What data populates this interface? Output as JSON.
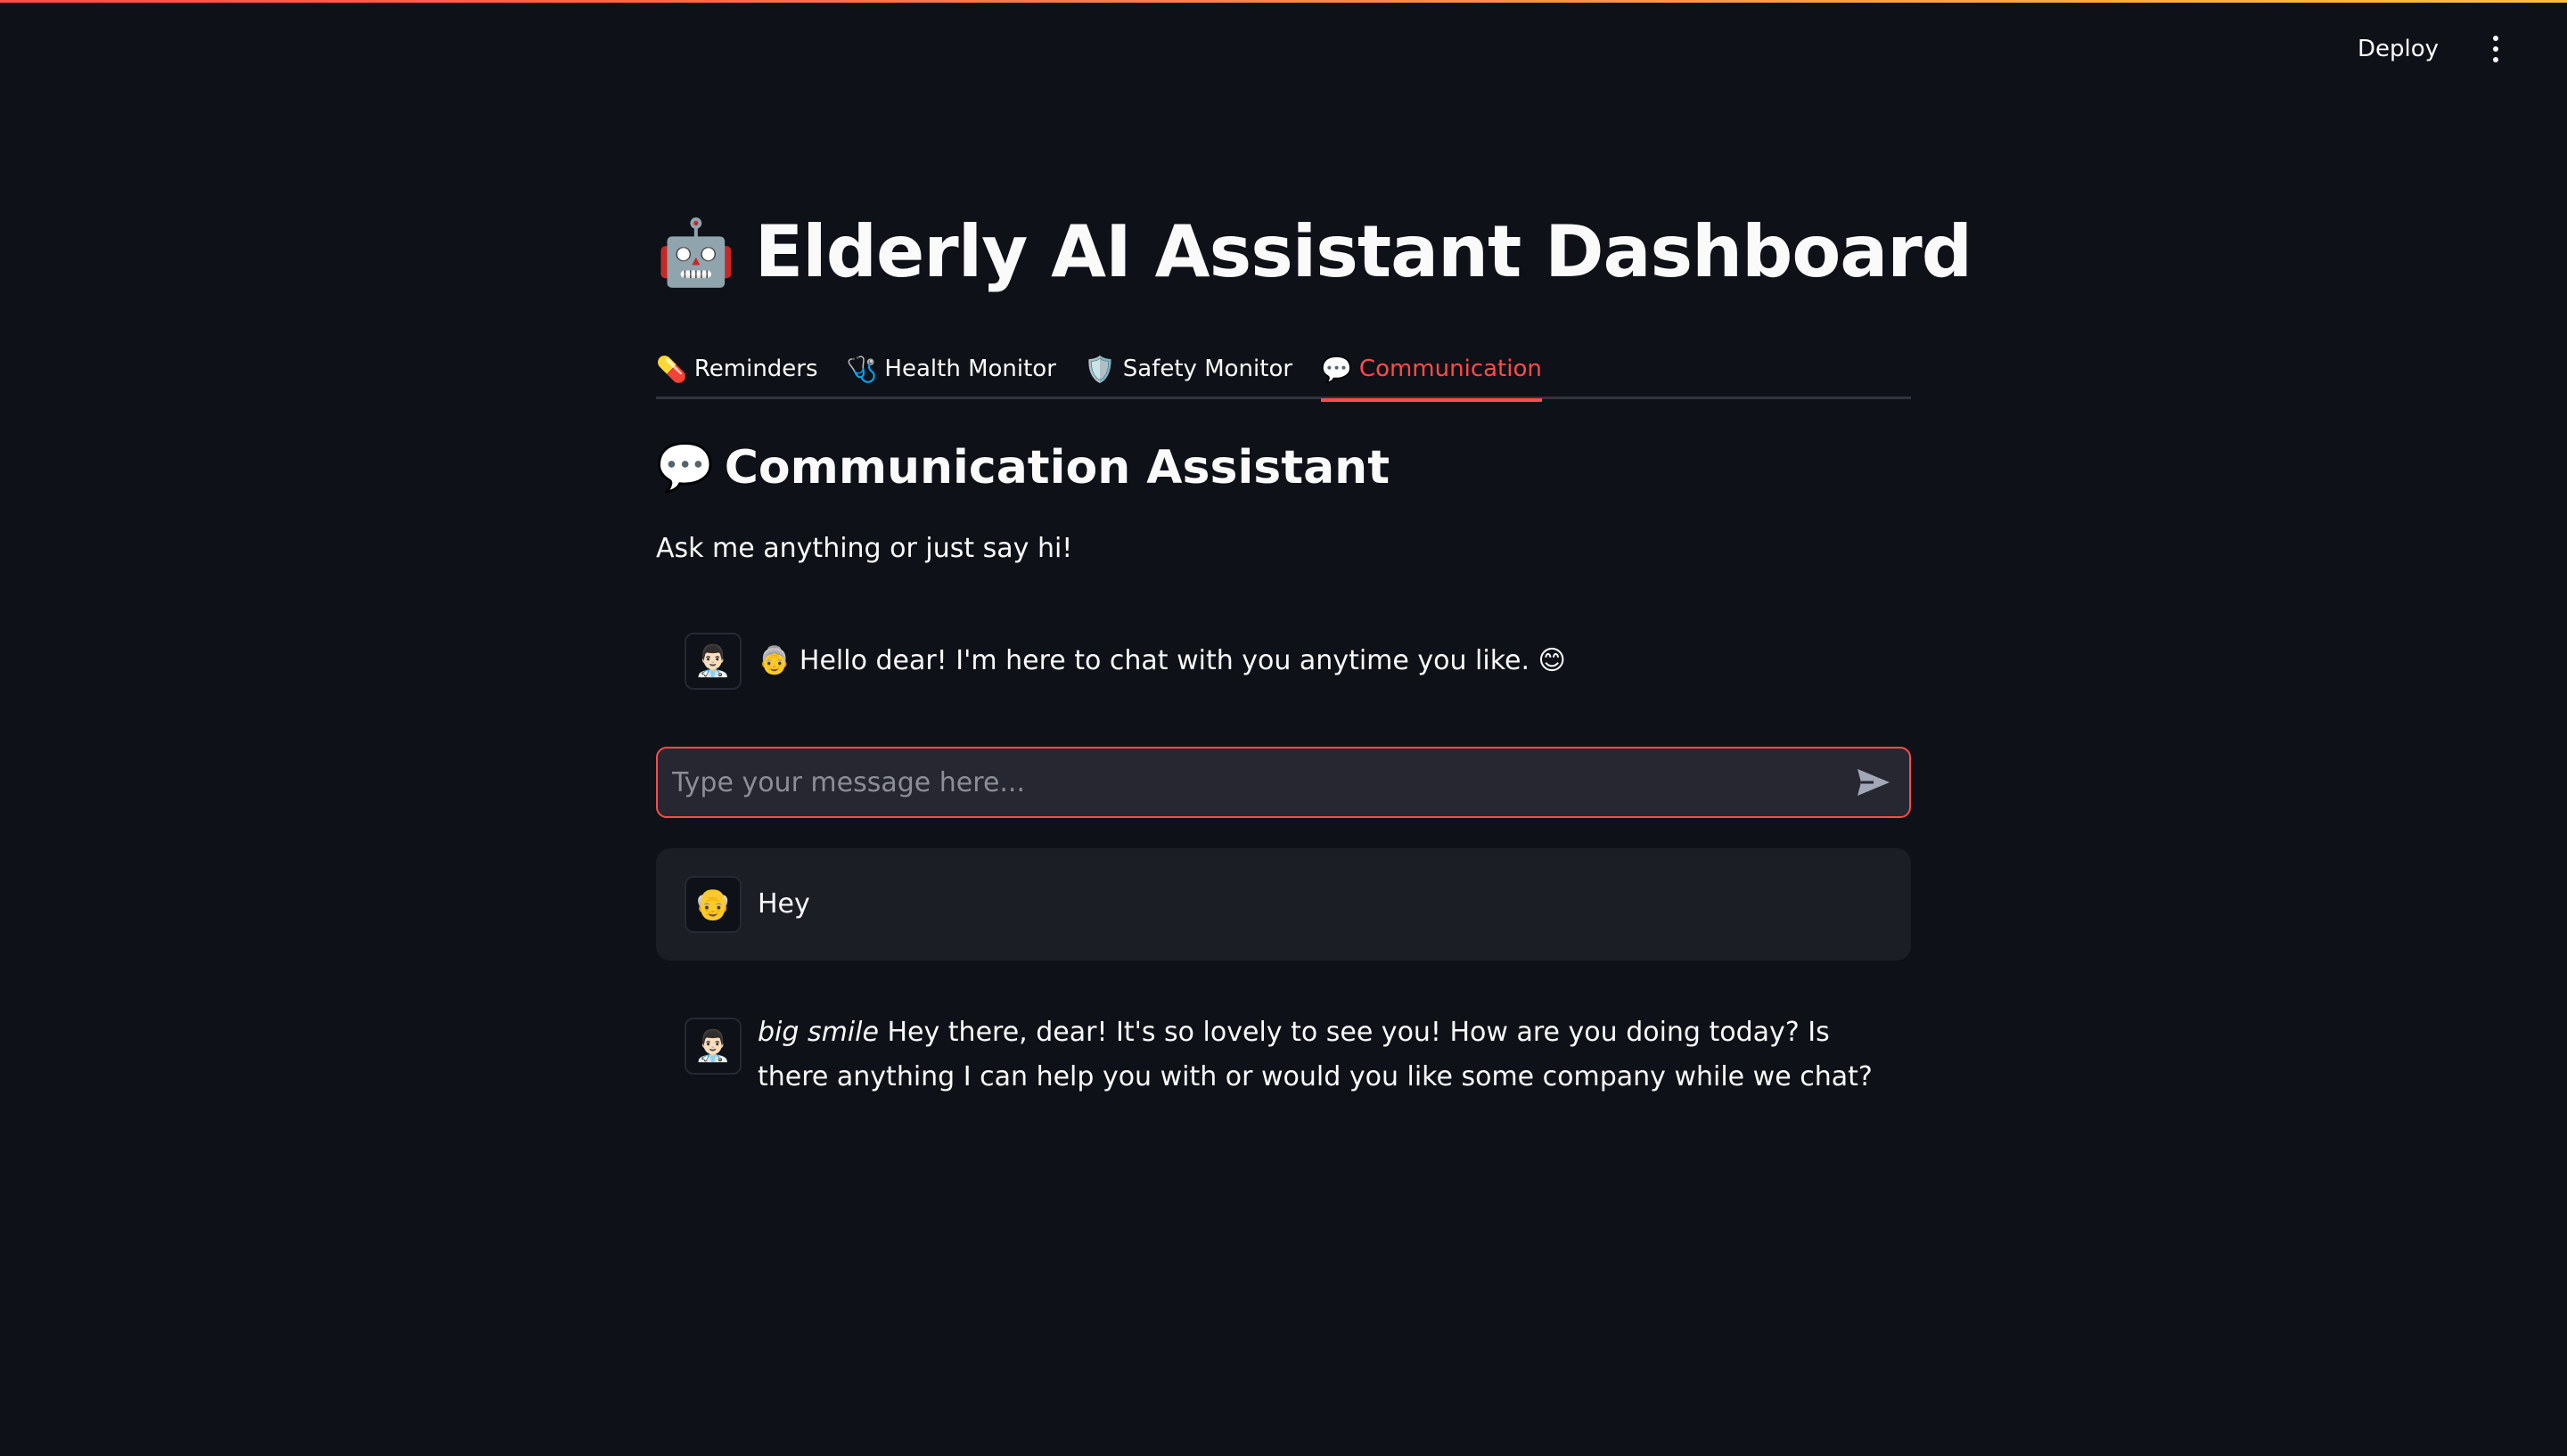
{
  "header": {
    "deploy_label": "Deploy",
    "menu_icon": "kebab-menu-icon"
  },
  "page": {
    "title": "Elderly AI Assistant Dashboard",
    "title_emoji": "🤖"
  },
  "tabs": [
    {
      "icon": "💊",
      "label": "Reminders",
      "active": false
    },
    {
      "icon": "🩺",
      "label": "Health Monitor",
      "active": false
    },
    {
      "icon": "🛡️",
      "label": "Safety Monitor",
      "active": false
    },
    {
      "icon": "💬",
      "label": "Communication",
      "active": true
    }
  ],
  "section": {
    "icon": "💬",
    "title": "Communication Assistant",
    "intro": "Ask me anything or just say hi!"
  },
  "chat_input": {
    "placeholder": "Type your message here...",
    "value": "",
    "send_icon": "send-icon"
  },
  "messages": [
    {
      "role": "assistant",
      "avatar": "👨🏻‍⚕️",
      "text": "👵 Hello dear! I'm here to chat with you anytime you like. 😊"
    },
    {
      "role": "user",
      "avatar": "👴",
      "text": "Hey"
    },
    {
      "role": "assistant",
      "avatar": "👨🏻‍⚕️",
      "emphasis": "big smile",
      "text": "Hey there, dear! It's so lovely to see you! How are you doing today? Is there anything I can help you with or would you like some company while we chat?"
    }
  ],
  "colors": {
    "background": "#0e1117",
    "accent": "#ff4b4b",
    "text": "#fafafa",
    "user_message_bg": "#1c1e26",
    "input_bg": "#262730"
  }
}
